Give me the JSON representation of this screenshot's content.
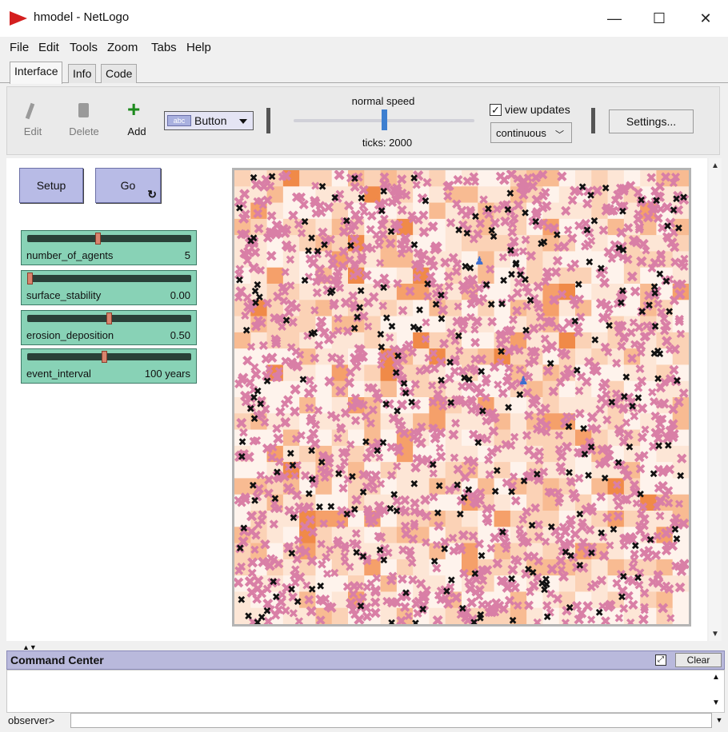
{
  "window": {
    "title": "hmodel - NetLogo",
    "logo_icon": "netlogo-red-arrow-icon",
    "minimize_glyph": "—",
    "maximize_glyph": "☐",
    "close_glyph": "✕"
  },
  "menu": [
    "File",
    "Edit",
    "Tools",
    "Zoom",
    "Tabs",
    "Help"
  ],
  "tabs": [
    "Interface",
    "Info",
    "Code"
  ],
  "active_tab": "Interface",
  "toolbar": {
    "edit_label": "Edit",
    "delete_label": "Delete",
    "add_label": "Add",
    "widget_type": "Button",
    "widget_type_icon_text": "abc",
    "speed_label": "normal speed",
    "speed_fraction": 0.5,
    "ticks_label": "ticks: 2000",
    "view_updates_label": "view updates",
    "view_updates_checked": true,
    "view_updates_check_glyph": "✓",
    "update_mode": "continuous",
    "settings_label": "Settings..."
  },
  "buttons": {
    "setup_label": "Setup",
    "go_label": "Go",
    "go_forever_icon": "forever-loop-icon"
  },
  "sliders": [
    {
      "name": "number_of_agents",
      "value": "5",
      "fraction": 0.43
    },
    {
      "name": "surface_stability",
      "value": "0.00",
      "fraction": 0.0
    },
    {
      "name": "erosion_deposition",
      "value": "0.50",
      "fraction": 0.5
    },
    {
      "name": "event_interval",
      "value": "100 years",
      "fraction": 0.47
    }
  ],
  "world": {
    "patch_palette": [
      "#fef3ec",
      "#fde6d6",
      "#fbd2b6",
      "#f8bb92",
      "#f5a06a",
      "#f08a48"
    ],
    "pink_marker_color": "#d97fa6",
    "black_marker_color": "#111111",
    "agent_color": "#3d6fd0",
    "marker_glyph": "✖",
    "agent_glyph": "🚶"
  },
  "command_center": {
    "title": "Command Center",
    "clear_label": "Clear",
    "prompt": "observer>",
    "input_value": ""
  }
}
